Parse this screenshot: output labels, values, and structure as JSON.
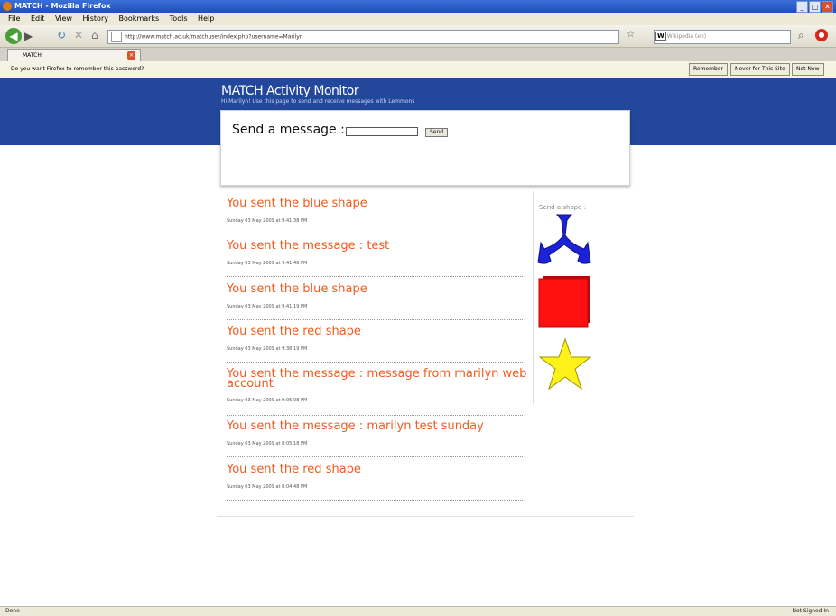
{
  "window": {
    "title": "MATCH - Mozilla Firefox",
    "controls": [
      "_",
      "□",
      "✕"
    ]
  },
  "menu": [
    "File",
    "Edit",
    "View",
    "History",
    "Bookmarks",
    "Tools",
    "Help"
  ],
  "nav": {
    "url": "http://www.match.ac.uk/matchuser/index.php?username=Marilyn",
    "search_engine": "W",
    "search_placeholder": "Wikipedia (en)"
  },
  "tab": {
    "label": "MATCH"
  },
  "password_bar": {
    "message": "Do you want Firefox to remember this password?",
    "buttons": [
      "Remember",
      "Never for This Site",
      "Not Now"
    ]
  },
  "page": {
    "site_title": "MATCH Activity Monitor",
    "subtitle": "Hi Marilyn! Use this page to send and receive messages with Lemmons",
    "send_label": "Send a message :",
    "message_value": "",
    "send_button": "Send",
    "shape_label": "Send a shape :",
    "shapes": [
      {
        "name": "blue-tristar",
        "color": "#1c22d8"
      },
      {
        "name": "red-square",
        "color": "#ff1010"
      },
      {
        "name": "yellow-star",
        "color": "#fff21a"
      }
    ]
  },
  "feed": [
    {
      "text": "You sent the blue shape",
      "time": "Sunday 03 May 2009 at 9:41:38 PM"
    },
    {
      "text": "You sent the message : test",
      "time": "Sunday 03 May 2009 at 9:41:48 PM"
    },
    {
      "text": "You sent the blue shape",
      "time": "Sunday 03 May 2009 at 9:41:19 PM"
    },
    {
      "text": "You sent the red shape",
      "time": "Sunday 03 May 2009 at 9:38:19 PM"
    },
    {
      "text": "You sent the message : message from marilyn web account",
      "time": "Sunday 03 May 2009 at 9:06:08 PM"
    },
    {
      "text": "You sent the message : marilyn test sunday",
      "time": "Sunday 03 May 2009 at 8:05:18 PM"
    },
    {
      "text": "You sent the red shape",
      "time": "Sunday 03 May 2009 at 8:04:48 PM"
    }
  ],
  "status": {
    "left": "Done",
    "right": "Not Signed In"
  }
}
